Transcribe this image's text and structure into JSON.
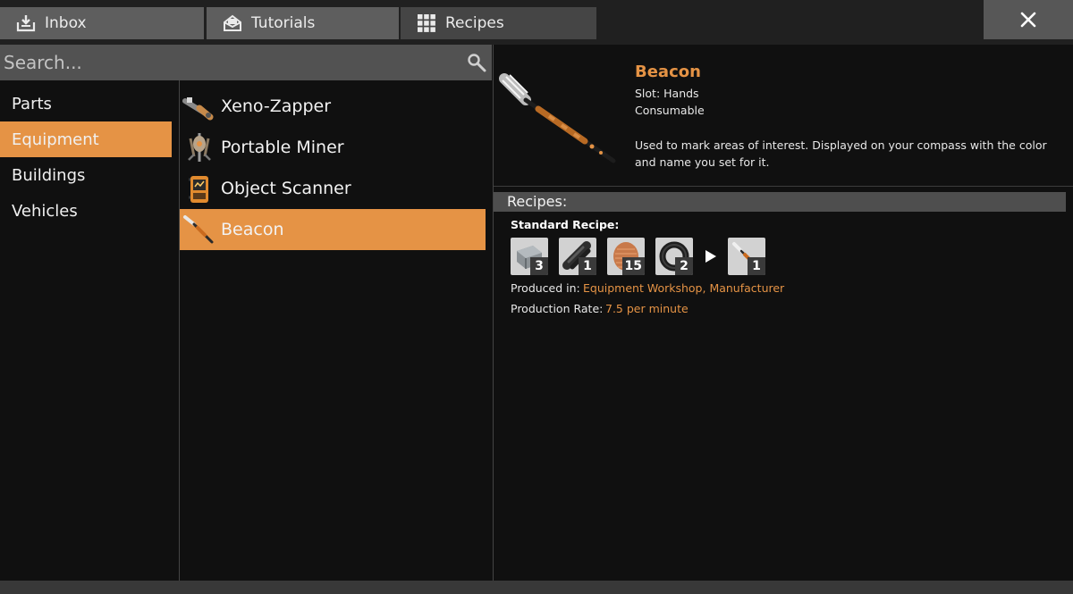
{
  "tabs": [
    {
      "label": "Inbox",
      "icon": "inbox-icon"
    },
    {
      "label": "Tutorials",
      "icon": "tutorials-icon"
    },
    {
      "label": "Recipes",
      "icon": "grid-icon",
      "active": true
    }
  ],
  "close_icon": "close-icon",
  "search": {
    "placeholder": "Search...",
    "value": "",
    "icon": "search-icon"
  },
  "categories": [
    {
      "label": "Parts"
    },
    {
      "label": "Equipment",
      "active": true
    },
    {
      "label": "Buildings"
    },
    {
      "label": "Vehicles"
    }
  ],
  "items": [
    {
      "label": "Xeno-Zapper",
      "icon": "xeno-zapper-icon"
    },
    {
      "label": "Portable Miner",
      "icon": "portable-miner-icon"
    },
    {
      "label": "Object Scanner",
      "icon": "object-scanner-icon"
    },
    {
      "label": "Beacon",
      "icon": "beacon-icon",
      "active": true
    }
  ],
  "detail": {
    "title": "Beacon",
    "slot": "Slot: Hands",
    "kind": "Consumable",
    "description": "Used to mark areas of interest. Displayed on your compass with the color and name you set for it.",
    "image_icon": "beacon-icon"
  },
  "recipes": {
    "header": "Recipes:",
    "standard_label": "Standard Recipe:",
    "inputs": [
      {
        "icon": "plate-icon",
        "count": "3"
      },
      {
        "icon": "rod-icon",
        "count": "1"
      },
      {
        "icon": "wire-icon",
        "count": "15"
      },
      {
        "icon": "cable-icon",
        "count": "2"
      }
    ],
    "output": {
      "icon": "beacon-icon",
      "count": "1"
    },
    "produced_in_label": "Produced in:",
    "produced_in_value": "Equipment Workshop, Manufacturer",
    "rate_label": "Production Rate:",
    "rate_value": "7.5 per minute"
  },
  "colors": {
    "accent": "#e59345",
    "background": "#101010",
    "panel": "#525252"
  }
}
